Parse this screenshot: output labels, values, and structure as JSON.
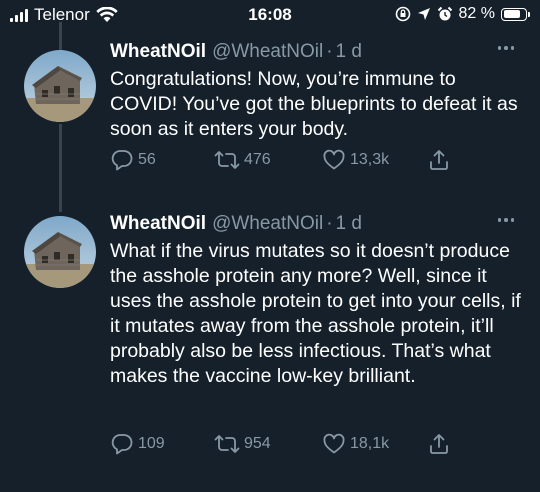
{
  "status_bar": {
    "carrier": "Telenor",
    "time": "16:08",
    "battery_percent": "82 %",
    "battery_level": 0.82,
    "icons": [
      "signal-icon",
      "wifi-icon",
      "screen-lock-rotation-icon",
      "location-icon",
      "alarm-icon",
      "battery-icon"
    ]
  },
  "tweets": [
    {
      "name": "WheatNOil",
      "handle": "@WheatNOil",
      "separator": "·",
      "time": "1 d",
      "text": "Congratulations! Now, you’re immune to COVID! You’ve got the blueprints to defeat it as soon as it enters your body.",
      "replies": "56",
      "retweets": "476",
      "likes": "13,3k"
    },
    {
      "name": "WheatNOil",
      "handle": "@WheatNOil",
      "separator": "·",
      "time": "1 d",
      "text": "What if the virus mutates so it doesn’t produce the asshole protein any more? Well, since it uses the asshole protein to get into your cells, if it mutates away from the asshole protein, it’ll probably also be less infectious. That’s what makes the vaccine low-key brilliant.",
      "replies": "109",
      "retweets": "954",
      "likes": "18,1k"
    }
  ],
  "colors": {
    "background": "#15202b",
    "secondary_text": "#8899a6",
    "thread_line": "#38444d"
  }
}
